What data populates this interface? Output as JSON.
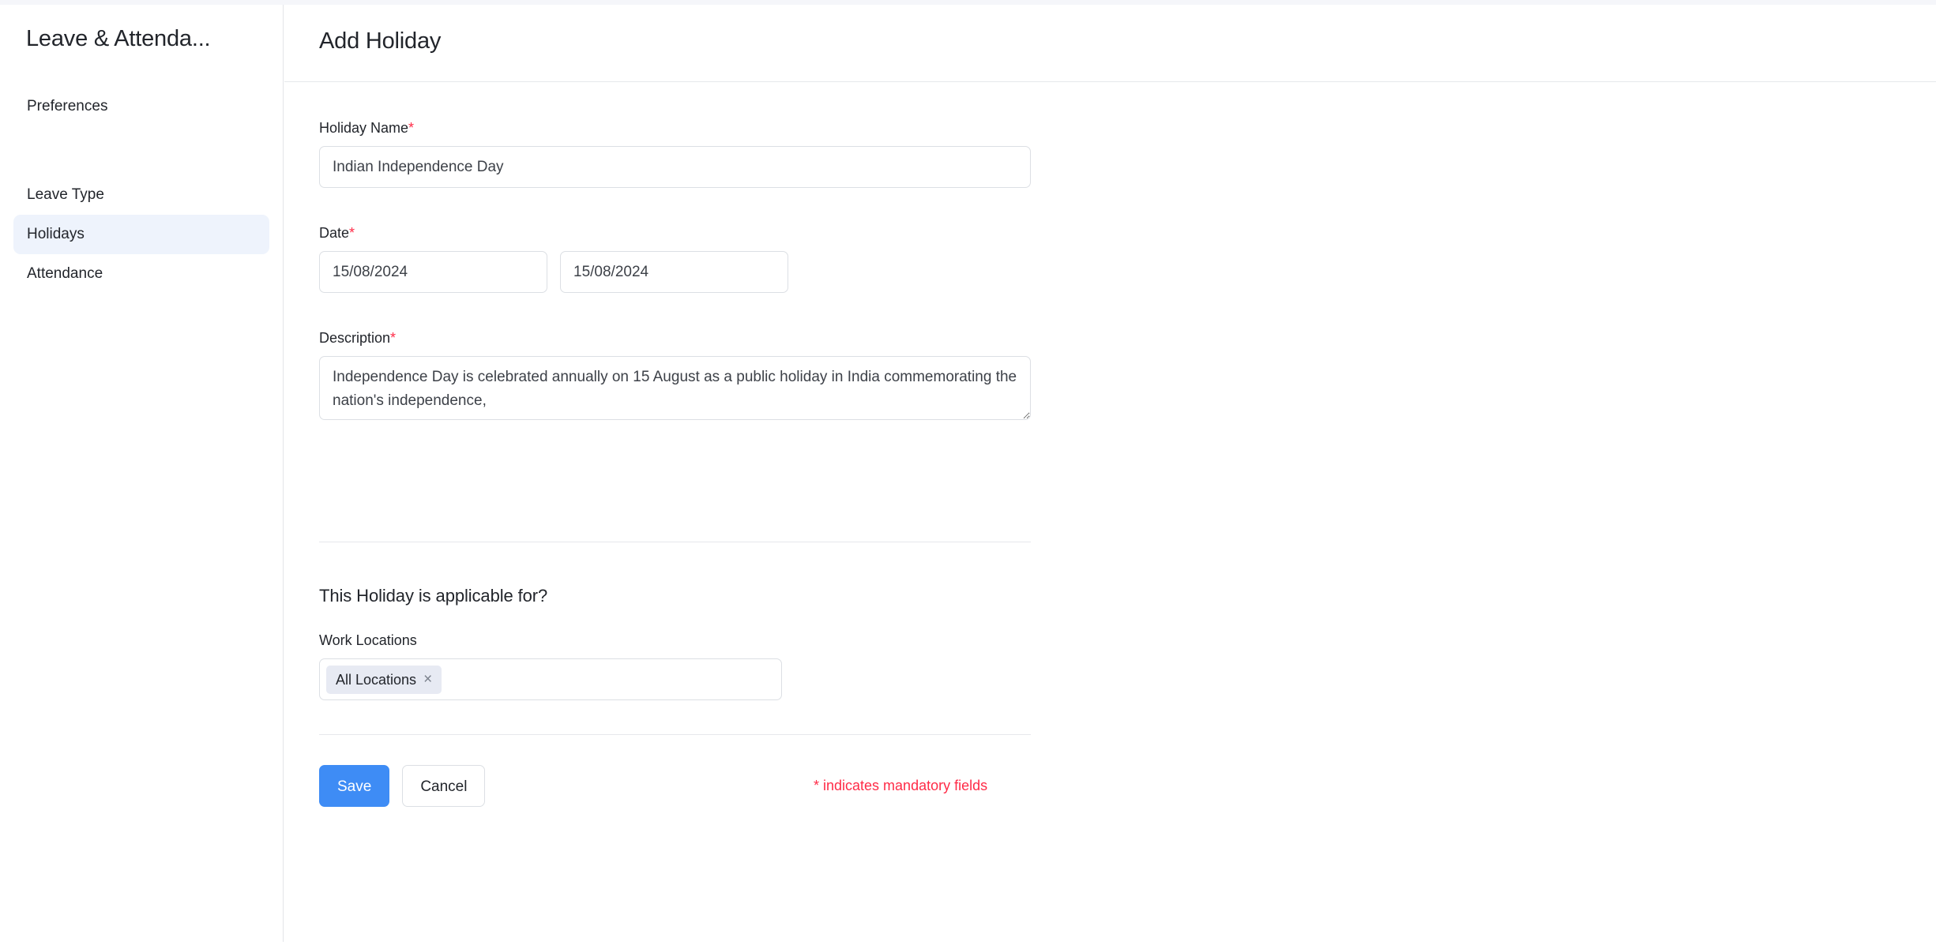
{
  "sidebar": {
    "title": "Leave & Attenda...",
    "items": [
      {
        "label": "Preferences",
        "active": false
      },
      {
        "label": "Leave Type",
        "active": false
      },
      {
        "label": "Holidays",
        "active": true
      },
      {
        "label": "Attendance",
        "active": false
      }
    ]
  },
  "header": {
    "title": "Add Holiday"
  },
  "form": {
    "holiday_name": {
      "label": "Holiday Name",
      "required_mark": "*",
      "value": "Indian Independence Day",
      "placeholder": ""
    },
    "date": {
      "label": "Date",
      "required_mark": "*",
      "from_value": "15/08/2024",
      "to_value": "15/08/2024",
      "placeholder": "dd/MM/yyyy"
    },
    "description": {
      "label": "Description",
      "required_mark": "*",
      "value": "Independence Day is celebrated annually on 15 August as a public holiday in India commemorating the nation's independence,",
      "placeholder": ""
    },
    "applicable_section": {
      "heading": "This Holiday is applicable for?",
      "work_locations_label": "Work Locations",
      "selected_chips": [
        {
          "label": "All Locations",
          "remove_icon": "×"
        }
      ]
    }
  },
  "actions": {
    "save_label": "Save",
    "cancel_label": "Cancel",
    "mandatory_note": "* indicates mandatory fields"
  },
  "colors": {
    "primary": "#3e8cf5",
    "required": "#ff2b47",
    "active_nav_bg": "#eef3fc",
    "chip_bg": "#e7eaf3",
    "border": "#dcdfe4"
  }
}
